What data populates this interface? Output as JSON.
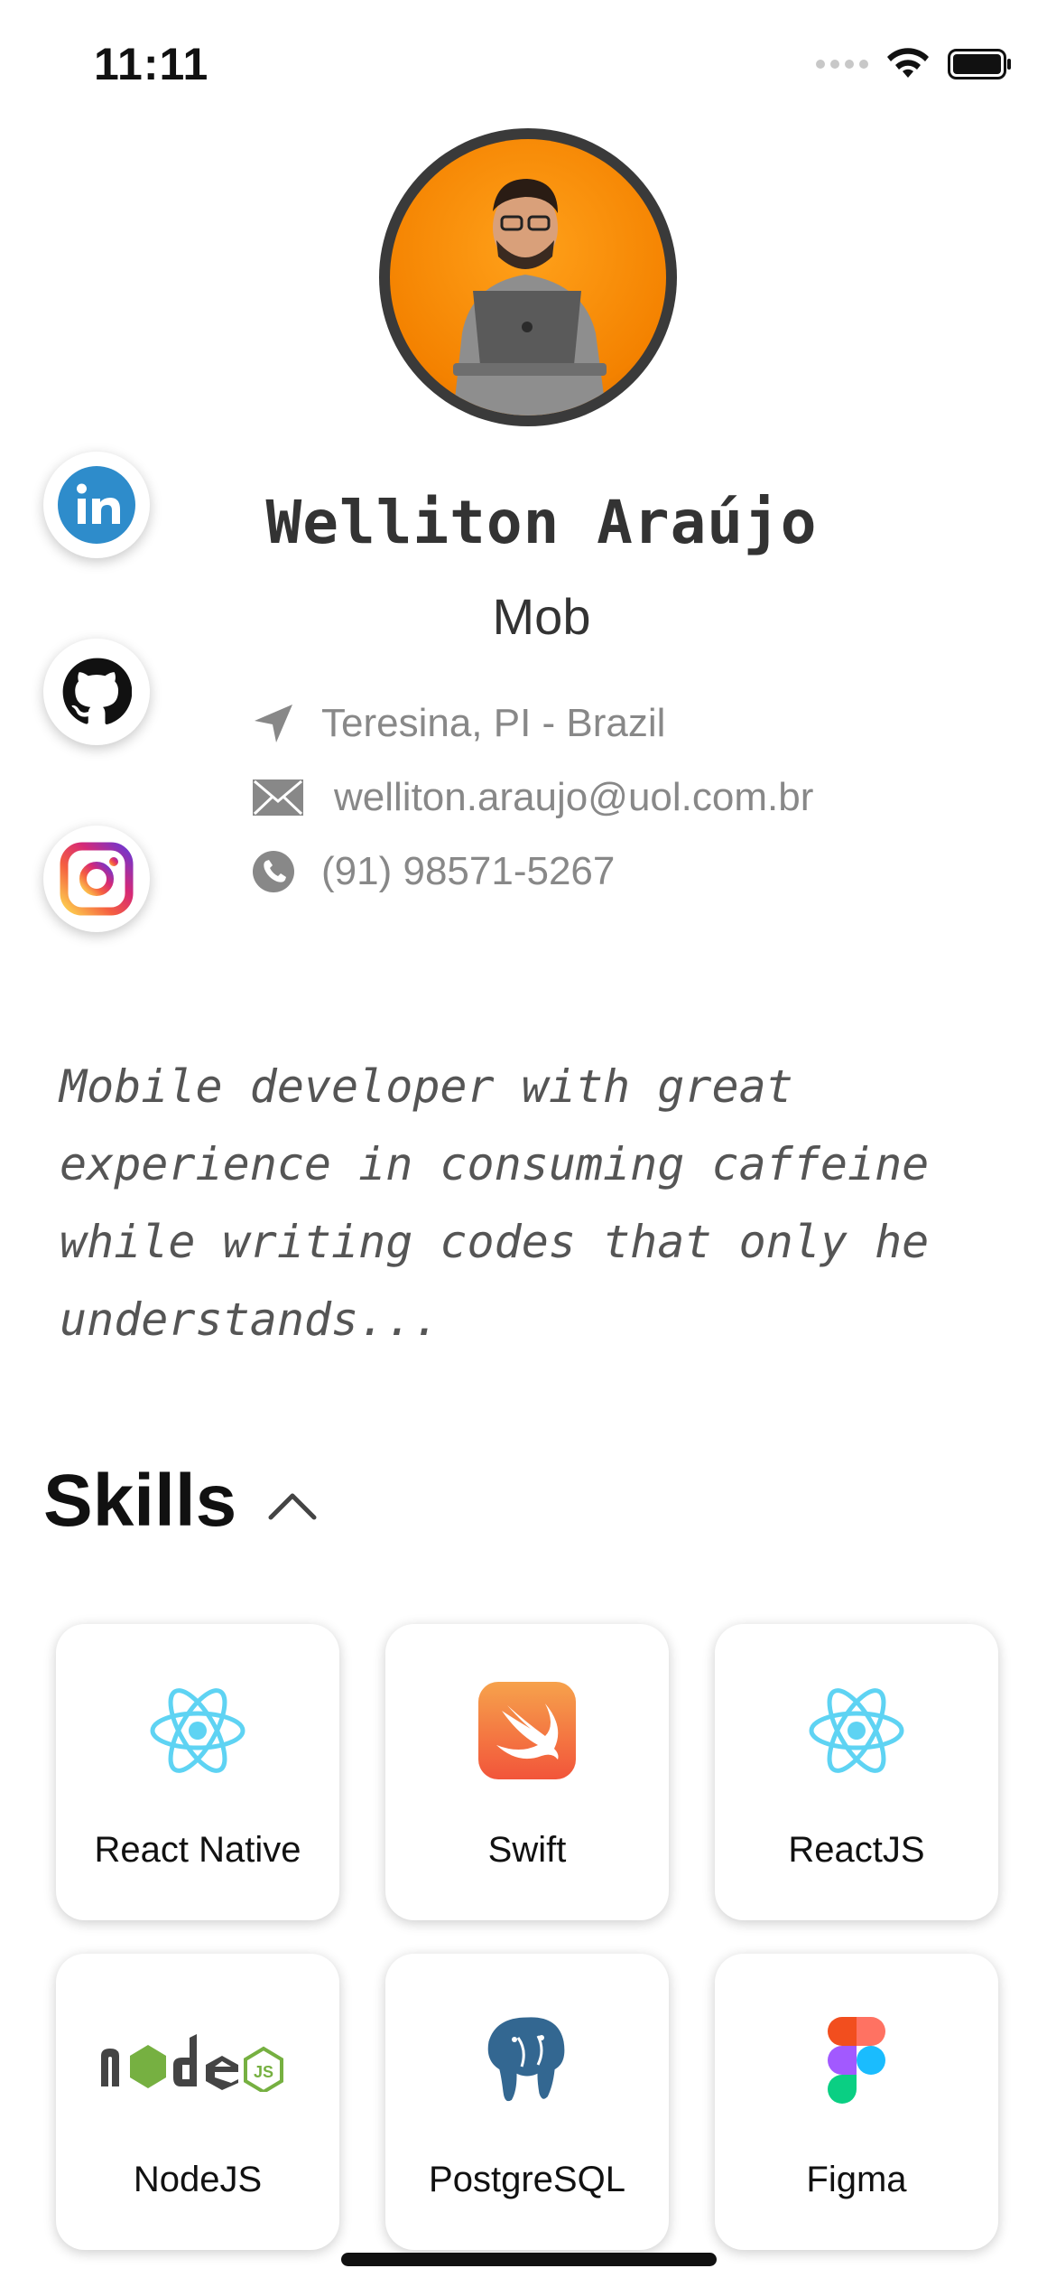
{
  "status": {
    "time": "11:11"
  },
  "profile": {
    "name": "Welliton Araújo",
    "role": "Mob",
    "location": "Teresina, PI - Brazil",
    "email": "welliton.araujo@uol.com.br",
    "phone": "(91) 98571-5267"
  },
  "social": [
    "linkedin-icon",
    "github-icon",
    "instagram-icon"
  ],
  "bio": "Mobile developer with great\nexperience in consuming caffeine\nwhile writing codes that only he\nunderstands...",
  "skills": {
    "title": "Skills",
    "items": [
      {
        "label": "React Native",
        "icon": "react-icon"
      },
      {
        "label": "Swift",
        "icon": "swift-icon"
      },
      {
        "label": "ReactJS",
        "icon": "react-icon"
      },
      {
        "label": "NodeJS",
        "icon": "nodejs-icon"
      },
      {
        "label": "PostgreSQL",
        "icon": "postgresql-icon"
      },
      {
        "label": "Figma",
        "icon": "figma-icon"
      }
    ]
  },
  "colors": {
    "accent_orange": "#f48200",
    "linkedin": "#2e8ccb",
    "react": "#5ed3f3",
    "text_muted": "#888888"
  }
}
